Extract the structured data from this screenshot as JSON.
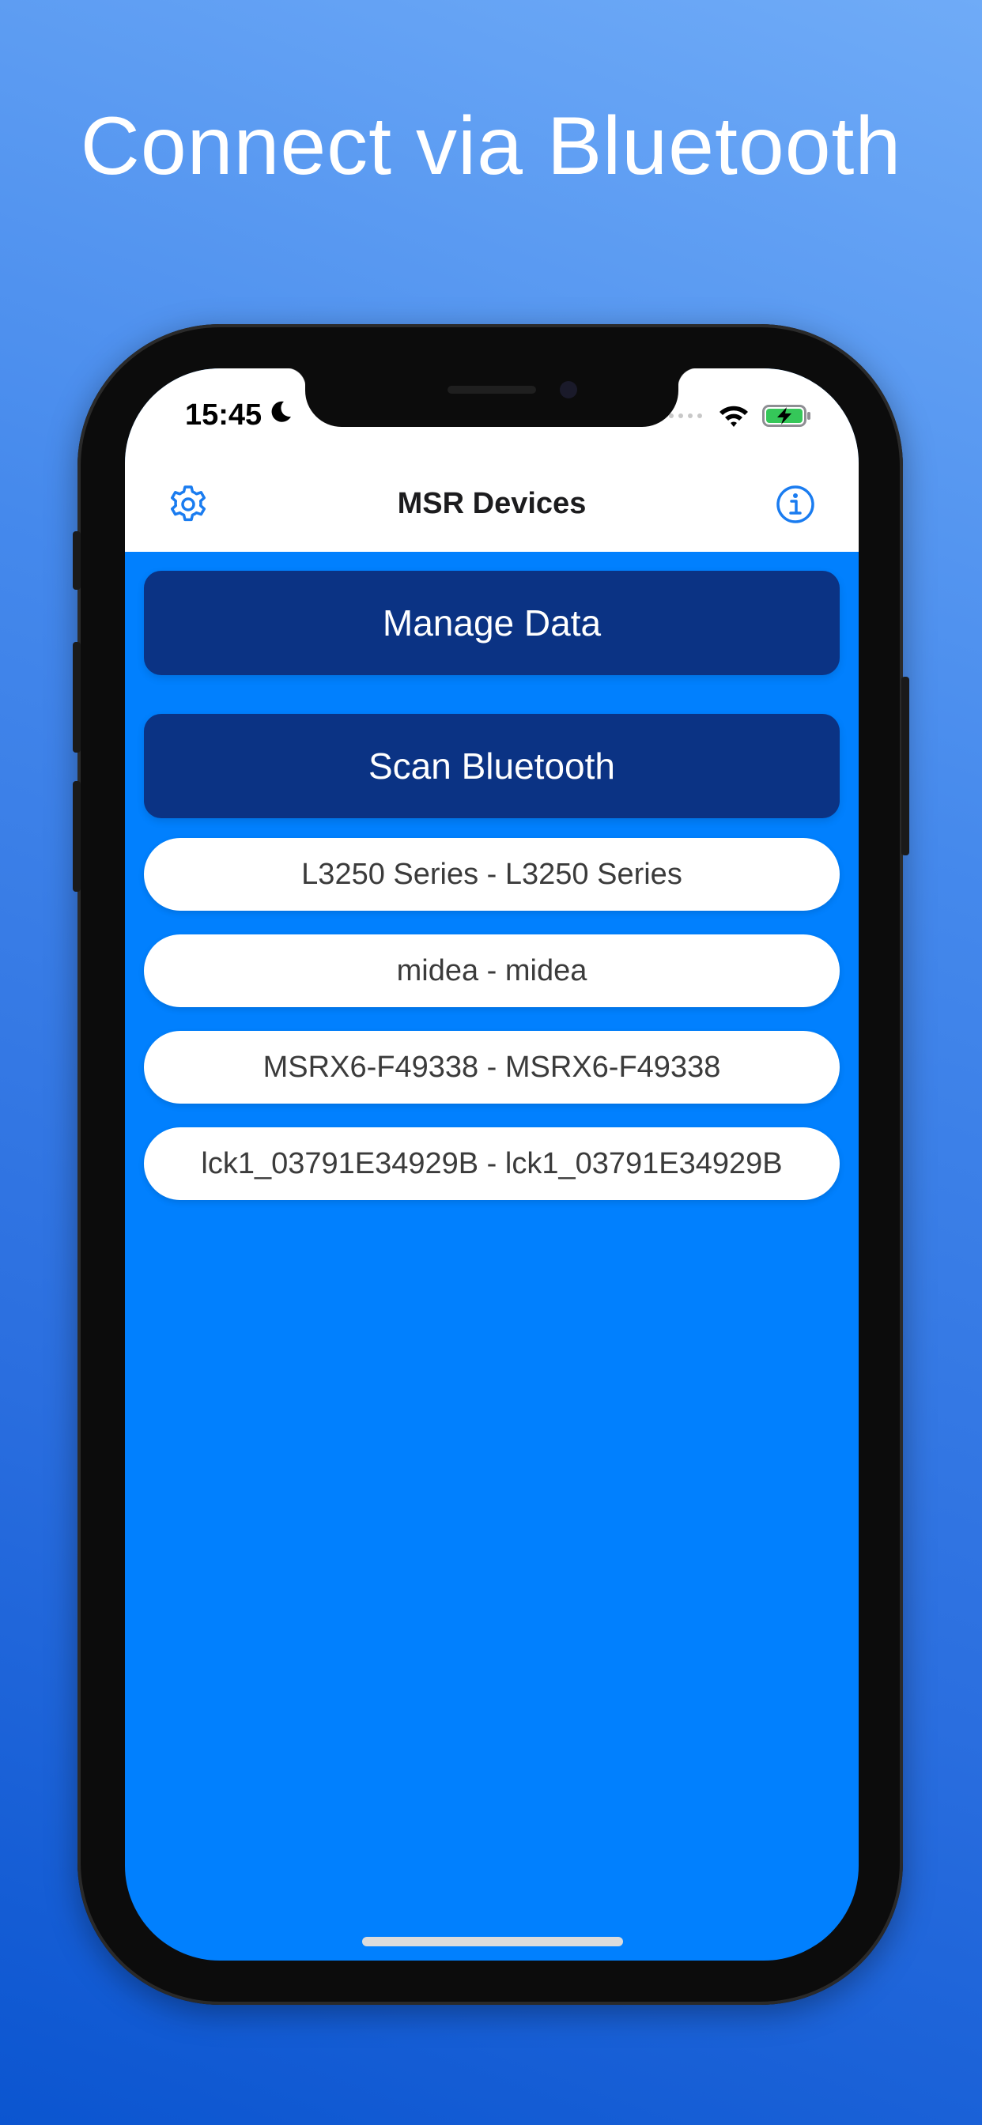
{
  "promo": {
    "headline": "Connect via Bluetooth"
  },
  "status_bar": {
    "time": "15:45",
    "moon_icon": "moon-icon",
    "signal_icon": "cellular-signal-icon",
    "wifi_icon": "wifi-icon",
    "battery_icon": "battery-charging-icon"
  },
  "navbar": {
    "title": "MSR Devices",
    "left_icon": "gear-icon",
    "right_icon": "info-icon"
  },
  "actions": {
    "manage_data_label": "Manage Data",
    "scan_bluetooth_label": "Scan Bluetooth"
  },
  "devices": [
    {
      "label": "L3250 Series - L3250 Series"
    },
    {
      "label": "midea - midea"
    },
    {
      "label": "MSRX6-F49338 - MSRX6-F49338"
    },
    {
      "label": "lck1_03791E34929B - lck1_03791E34929B"
    }
  ],
  "colors": {
    "screen_background": "#0180fe",
    "button_background": "#0b3384",
    "accent": "#1a7cf0",
    "battery_green": "#35c759"
  }
}
